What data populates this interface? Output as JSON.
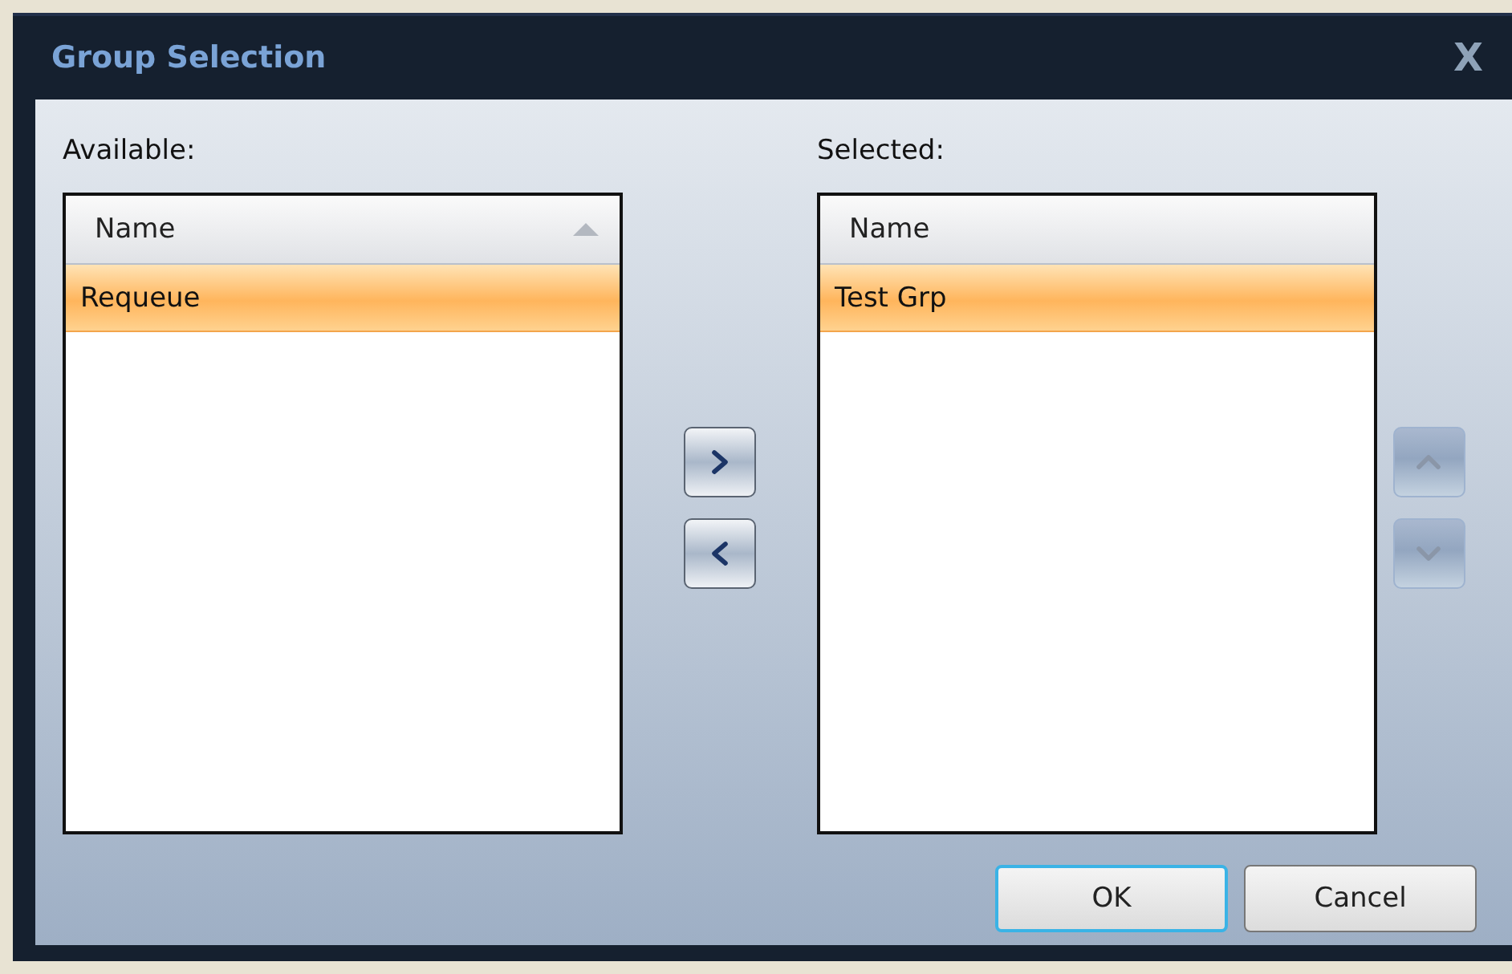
{
  "window": {
    "title": "Group Selection",
    "close": "X"
  },
  "lists": [
    {
      "label": "Available:",
      "column": "Name",
      "sorted": true,
      "rows": [
        {
          "name": "Requeue",
          "selected": true
        }
      ]
    },
    {
      "label": "Selected:",
      "column": "Name",
      "sorted": false,
      "rows": [
        {
          "name": "Test Grp",
          "selected": true
        }
      ]
    }
  ],
  "move_buttons": [
    {
      "kind": "right",
      "disabled": false
    },
    {
      "kind": "left",
      "disabled": false
    }
  ],
  "order_buttons": [
    {
      "kind": "up",
      "disabled": true
    },
    {
      "kind": "down",
      "disabled": true
    }
  ],
  "buttons": [
    {
      "label": "OK",
      "default": true
    },
    {
      "label": "Cancel",
      "default": false
    }
  ]
}
